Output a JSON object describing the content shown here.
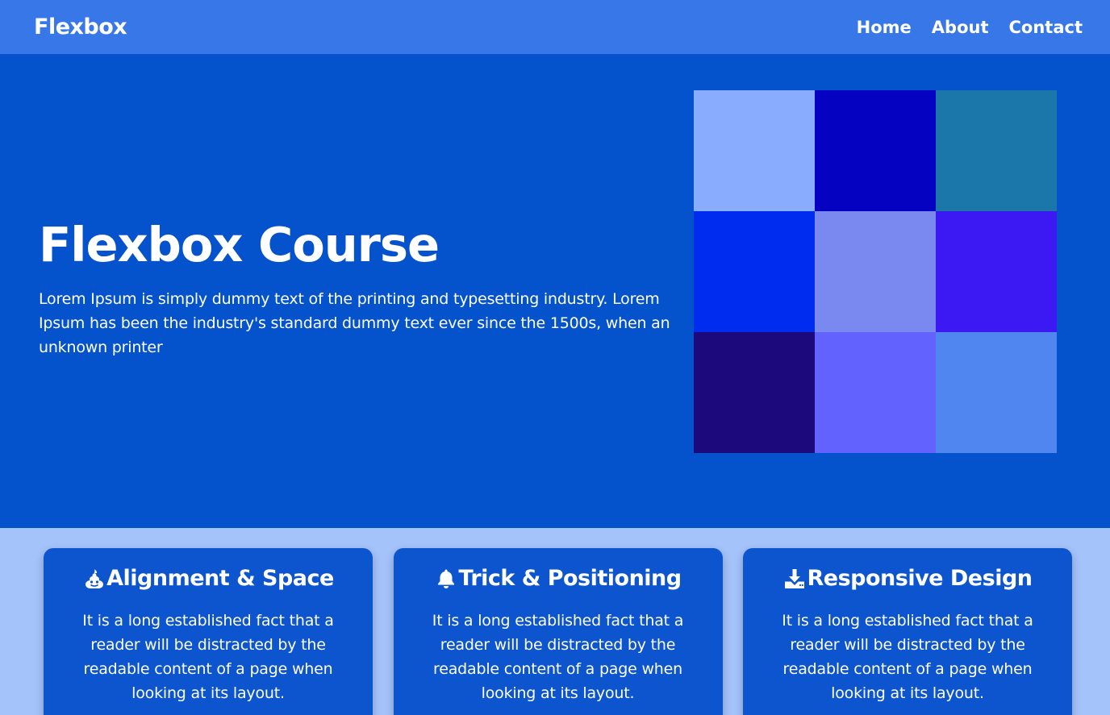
{
  "navbar": {
    "brand": "Flexbox",
    "links": [
      {
        "label": "Home"
      },
      {
        "label": "About"
      },
      {
        "label": "Contact"
      }
    ]
  },
  "hero": {
    "title": "Flexbox Course",
    "description": "Lorem Ipsum is simply dummy text of the printing and typesetting industry. Lorem Ipsum has been the industry's standard dummy text ever since the 1500s, when an unknown printer",
    "grid_colors": [
      "#8aacff",
      "#0502c2",
      "#1b76a9",
      "#002cf0",
      "#7a89f0",
      "#3c18f2",
      "#1c097b",
      "#6262ff",
      "#4f86f0"
    ]
  },
  "features": [
    {
      "icon": "poop-icon",
      "title": "Alignment & Space",
      "text": "It is a long established fact that a reader will be distracted by the readable content of a page when looking at its layout."
    },
    {
      "icon": "bell-icon",
      "title": "Trick & Positioning",
      "text": "It is a long established fact that a reader will be distracted by the readable content of a page when looking at its layout."
    },
    {
      "icon": "download-icon",
      "title": "Responsive Design",
      "text": "It is a long established fact that a reader will be distracted by the readable content of a page when looking at its layout."
    }
  ]
}
